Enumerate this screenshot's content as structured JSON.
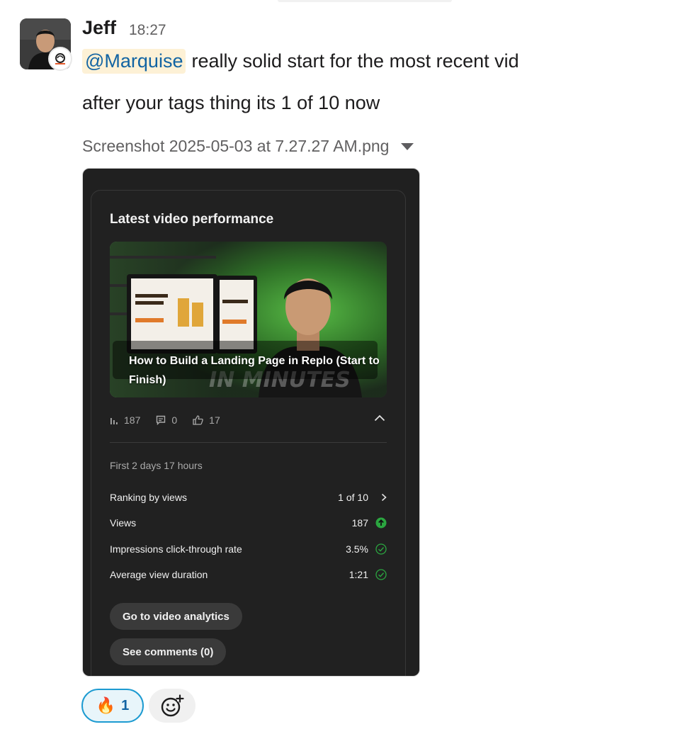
{
  "message": {
    "sender": "Jeff",
    "time": "18:27",
    "mention": "@Marquise",
    "line1_text": "really solid start for the most recent vid",
    "line2_text": "after your tags thing its 1 of 10 now"
  },
  "attachment": {
    "filename": "Screenshot 2025-05-03 at 7.27.27 AM.png"
  },
  "card": {
    "title": "Latest video performance",
    "video_title": "How to Build a Landing Page in Replo (Start to Finish)",
    "stats": {
      "views": "187",
      "comments": "0",
      "likes": "17"
    },
    "period": "First 2 days 17 hours",
    "metrics": [
      {
        "label": "Ranking by views",
        "value": "1 of 10"
      },
      {
        "label": "Views",
        "value": "187"
      },
      {
        "label": "Impressions click-through rate",
        "value": "3.5%"
      },
      {
        "label": "Average view duration",
        "value": "1:21"
      }
    ],
    "buttons": {
      "analytics": "Go to video analytics",
      "comments": "See comments (0)"
    }
  },
  "reactions": [
    {
      "emoji": "🔥",
      "count": "1"
    }
  ],
  "colors": {
    "mention_bg": "#fdf1d6",
    "mention_text": "#1264a3",
    "card_bg": "#212121",
    "accent_green": "#2ba640",
    "reaction_border": "#1d9bd1"
  }
}
